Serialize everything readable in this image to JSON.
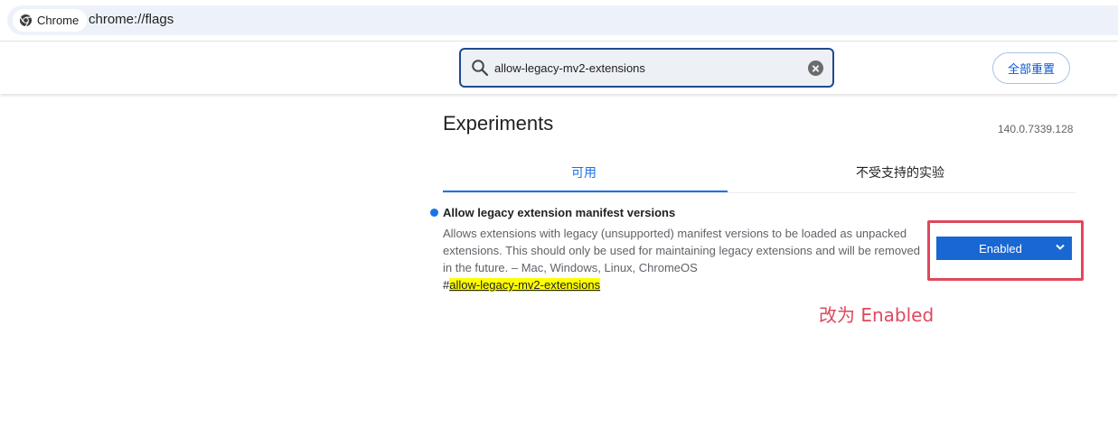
{
  "address_bar": {
    "chip_label": "Chrome",
    "chip_icon": "chrome-logo-icon",
    "url": "chrome://flags"
  },
  "header": {
    "search": {
      "value": "allow-legacy-mv2-extensions",
      "placeholder": "",
      "icon": "search-icon",
      "clear_icon": "clear-icon"
    },
    "reset_all_label": "全部重置"
  },
  "page": {
    "title": "Experiments",
    "version": "140.0.7339.128",
    "tabs": [
      {
        "label": "可用",
        "selected": true
      },
      {
        "label": "不受支持的实验",
        "selected": false
      }
    ]
  },
  "flag": {
    "name": "Allow legacy extension manifest versions",
    "description": "Allows extensions with legacy (unsupported) manifest versions to be loaded as unpacked extensions. This should only be used for maintaining legacy extensions and will be removed in the future. – Mac, Windows, Linux, ChromeOS",
    "link_hash": "#",
    "link_text": "allow-legacy-mv2-extensions",
    "status_value": "Enabled"
  },
  "annotation": {
    "text": "改为 Enabled"
  },
  "colors": {
    "accent": "#1a73e8",
    "select_bg": "#1967d2",
    "annotation_red": "#e0485d",
    "link_highlight": "#ffff00"
  }
}
